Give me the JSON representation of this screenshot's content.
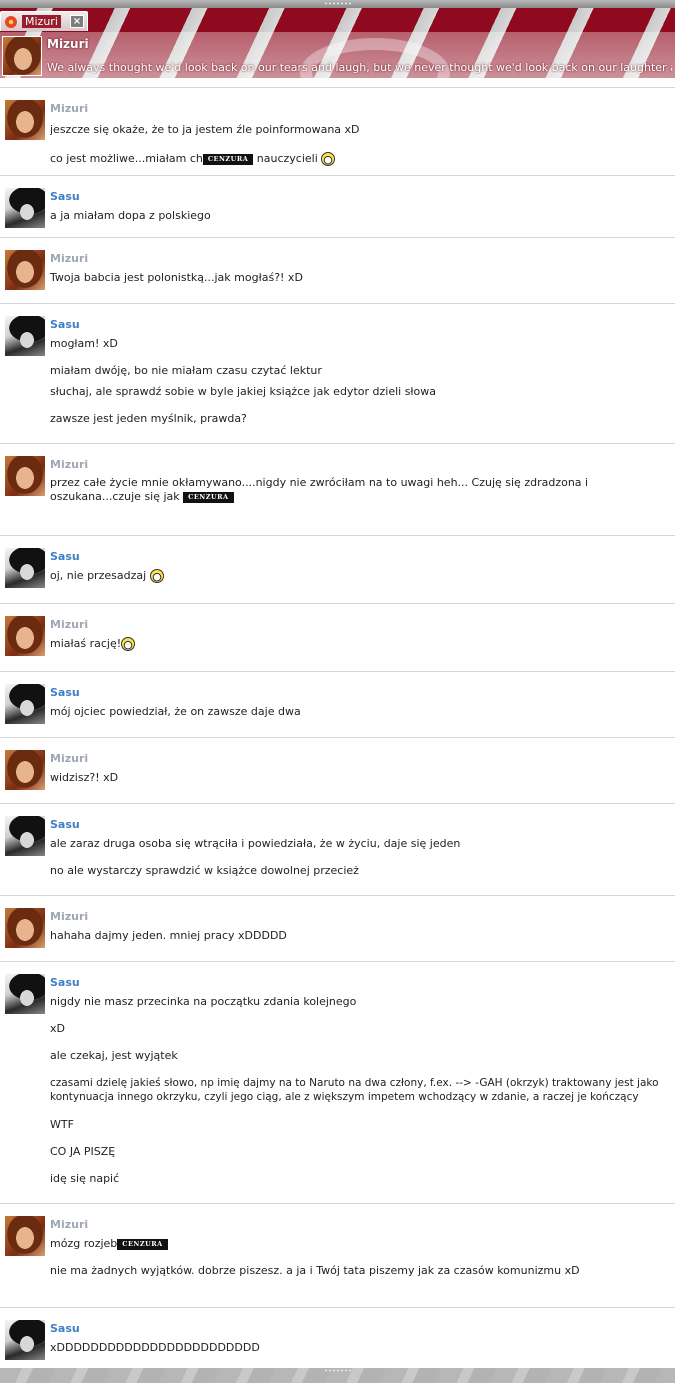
{
  "window": {
    "tab_title": "Mizuri",
    "close_glyph": "×",
    "contact_name": "Mizuri",
    "status_message": "We always thought we'd look back on our tears and laugh, but we never thought we'd look back on our laughter and cry."
  },
  "censor_label": "CENZURA",
  "icons": {
    "tab": "flower-icon",
    "emoticon": "laughing-smiley-icon",
    "avatar_mizuri": "mizuri-avatar",
    "avatar_sasu": "sasu-avatar"
  },
  "messages": [
    {
      "sender": "Mizuri",
      "lines": [
        "jeszcze się okaże, że to ja jestem źle poinformowana xD"
      ],
      "line2_pre": "co jest możliwe...miałam ch",
      "line2_post": "nauczycieli"
    },
    {
      "sender": "Sasu",
      "lines": [
        "a ja miałam dopa z polskiego"
      ]
    },
    {
      "sender": "Mizuri",
      "lines": [
        "Twoja babcia jest polonistką...jak mogłaś?! xD"
      ]
    },
    {
      "sender": "Sasu",
      "lines": [
        "mogłam! xD",
        "miałam dwóję, bo nie miałam czasu czytać lektur",
        "słuchaj, ale sprawdź sobie w byle jakiej książce jak edytor dzieli słowa",
        "zawsze jest jeden myślnik, prawda?"
      ]
    },
    {
      "sender": "Mizuri",
      "lines": [
        "przez całe życie mnie okłamywano....nigdy nie zwróciłam na to uwagi heh... Czuję się zdradzona i oszukana...czuje się jak"
      ]
    },
    {
      "sender": "Sasu",
      "lines": [
        "oj, nie przesadzaj"
      ]
    },
    {
      "sender": "Mizuri",
      "lines": [
        "miałaś rację!"
      ]
    },
    {
      "sender": "Sasu",
      "lines": [
        "mój ojciec powiedział, że on zawsze daje dwa"
      ]
    },
    {
      "sender": "Mizuri",
      "lines": [
        "widzisz?! xD"
      ]
    },
    {
      "sender": "Sasu",
      "lines": [
        "ale zaraz druga osoba się wtrąciła i powiedziała, że w życiu, daje się jeden",
        "no ale wystarczy sprawdzić w książce dowolnej przecież"
      ]
    },
    {
      "sender": "Mizuri",
      "lines": [
        "hahaha dajmy jeden. mniej pracy xDDDDD"
      ]
    },
    {
      "sender": "Sasu",
      "lines": [
        "nigdy nie masz przecinka na początku zdania kolejnego",
        "xD",
        "ale czekaj, jest wyjątek",
        "czasami dzielę jakieś słowo, np imię dajmy na to Naruto na dwa człony, f.ex. --> -GAH (okrzyk) traktowany jest jako kontynuacja innego okrzyku, czyli jego ciąg, ale z większym impetem wchodzący w zdanie, a raczej je kończący",
        "WTF",
        "CO JA PISZĘ",
        "idę się napić"
      ]
    },
    {
      "sender": "Mizuri",
      "lines": [
        "mózg rozjeb",
        "nie ma żadnych wyjątków. dobrze piszesz. a ja i Twój tata piszemy jak za czasów komunizmu xD"
      ]
    },
    {
      "sender": "Sasu",
      "lines": [
        "xDDDDDDDDDDDDDDDDDDDDDDDD"
      ]
    }
  ]
}
